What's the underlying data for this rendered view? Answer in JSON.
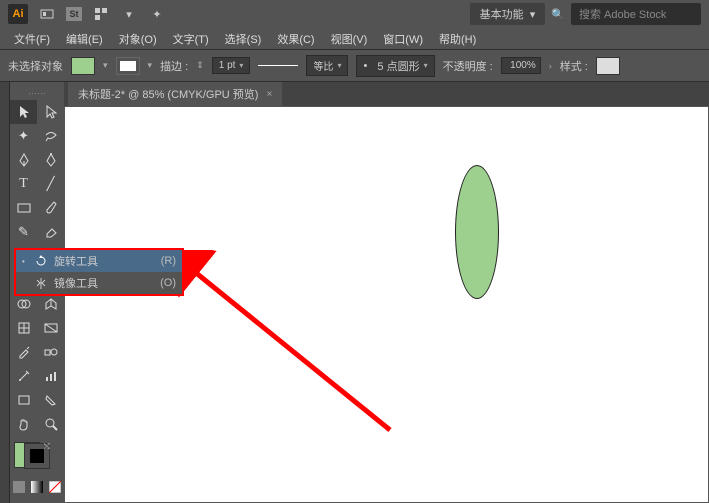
{
  "app": {
    "logo": "Ai"
  },
  "topbar": {
    "workspace": "基本功能",
    "search_placeholder": "搜索 Adobe Stock"
  },
  "menu": {
    "file": "文件(F)",
    "edit": "编辑(E)",
    "object": "对象(O)",
    "type": "文字(T)",
    "select": "选择(S)",
    "effect": "效果(C)",
    "view": "视图(V)",
    "window": "窗口(W)",
    "help": "帮助(H)"
  },
  "control": {
    "no_selection": "未选择对象",
    "stroke_label": "描边 :",
    "stroke_pt": "1 pt",
    "uniform": "等比",
    "brush": "5 点圆形",
    "opacity_label": "不透明度 :",
    "opacity_value": "100%",
    "style_label": "样式 :"
  },
  "tab": {
    "title": "未标题-2* @ 85% (CMYK/GPU 预览)"
  },
  "flyout": {
    "rotate": "旋转工具",
    "rotate_key": "(R)",
    "mirror": "镜像工具",
    "mirror_key": "(O)"
  }
}
